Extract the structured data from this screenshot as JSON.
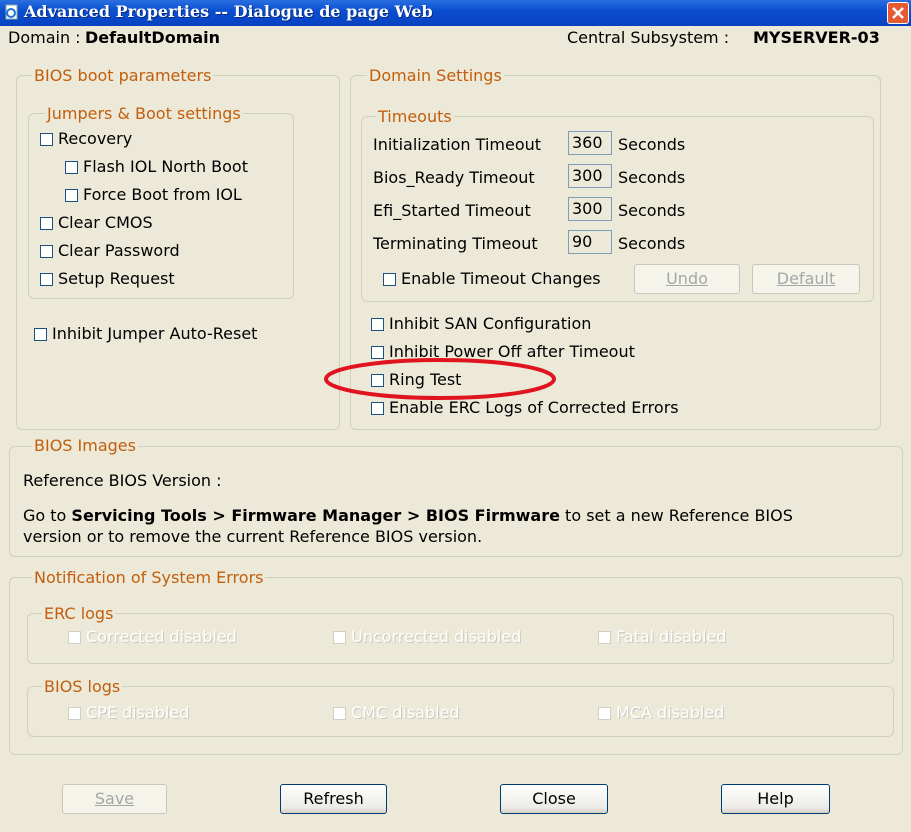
{
  "window": {
    "title": "Advanced Properties -- Dialogue de page Web"
  },
  "domain": {
    "label": "Domain :",
    "value": "DefaultDomain"
  },
  "subsystem": {
    "label": "Central Subsystem :",
    "value": "MYSERVER-03"
  },
  "bios_boot": {
    "legend": "BIOS boot parameters",
    "jumpers": {
      "legend": "Jumpers & Boot settings",
      "recovery": "Recovery",
      "flash_iol": "Flash IOL North Boot",
      "force_boot": "Force Boot from IOL",
      "clear_cmos": "Clear CMOS",
      "clear_password": "Clear Password",
      "setup_request": "Setup Request"
    },
    "inhibit_jumper": "Inhibit Jumper Auto-Reset"
  },
  "domain_settings": {
    "legend": "Domain Settings",
    "timeouts": {
      "legend": "Timeouts",
      "rows": [
        {
          "label": "Initialization Timeout",
          "value": "360",
          "unit": "Seconds"
        },
        {
          "label": "Bios_Ready Timeout",
          "value": "300",
          "unit": "Seconds"
        },
        {
          "label": "Efi_Started Timeout",
          "value": "300",
          "unit": "Seconds"
        },
        {
          "label": "Terminating Timeout",
          "value": "90",
          "unit": "Seconds"
        }
      ],
      "enable_changes": "Enable Timeout Changes",
      "undo": "Undo",
      "default": "Default"
    },
    "inhibit_san": "Inhibit SAN Configuration",
    "inhibit_power_off": "Inhibit Power Off after Timeout",
    "ring_test": "Ring Test",
    "enable_erc": "Enable ERC Logs of Corrected Errors"
  },
  "bios_images": {
    "legend": "BIOS Images",
    "reference_label": "Reference BIOS Version :",
    "goto_prefix": "Go to ",
    "goto_path": "Servicing Tools > Firmware Manager > BIOS Firmware",
    "goto_suffix": " to set a new Reference BIOS",
    "goto_line2": "version or to remove the current Reference BIOS version."
  },
  "notification": {
    "legend": "Notification of System Errors",
    "erc_logs": {
      "legend": "ERC logs",
      "items": [
        "Corrected disabled",
        "Uncorrected disabled",
        "Fatal disabled"
      ]
    },
    "bios_logs": {
      "legend": "BIOS logs",
      "items": [
        "CPE disabled",
        "CMC disabled",
        "MCA disabled"
      ]
    }
  },
  "buttons": {
    "save": "Save",
    "refresh": "Refresh",
    "close": "Close",
    "help": "Help"
  },
  "colors": {
    "legend": "#c25e0c",
    "titlebar": "#0a4fd0",
    "highlight_ellipse": "#e0141e"
  }
}
